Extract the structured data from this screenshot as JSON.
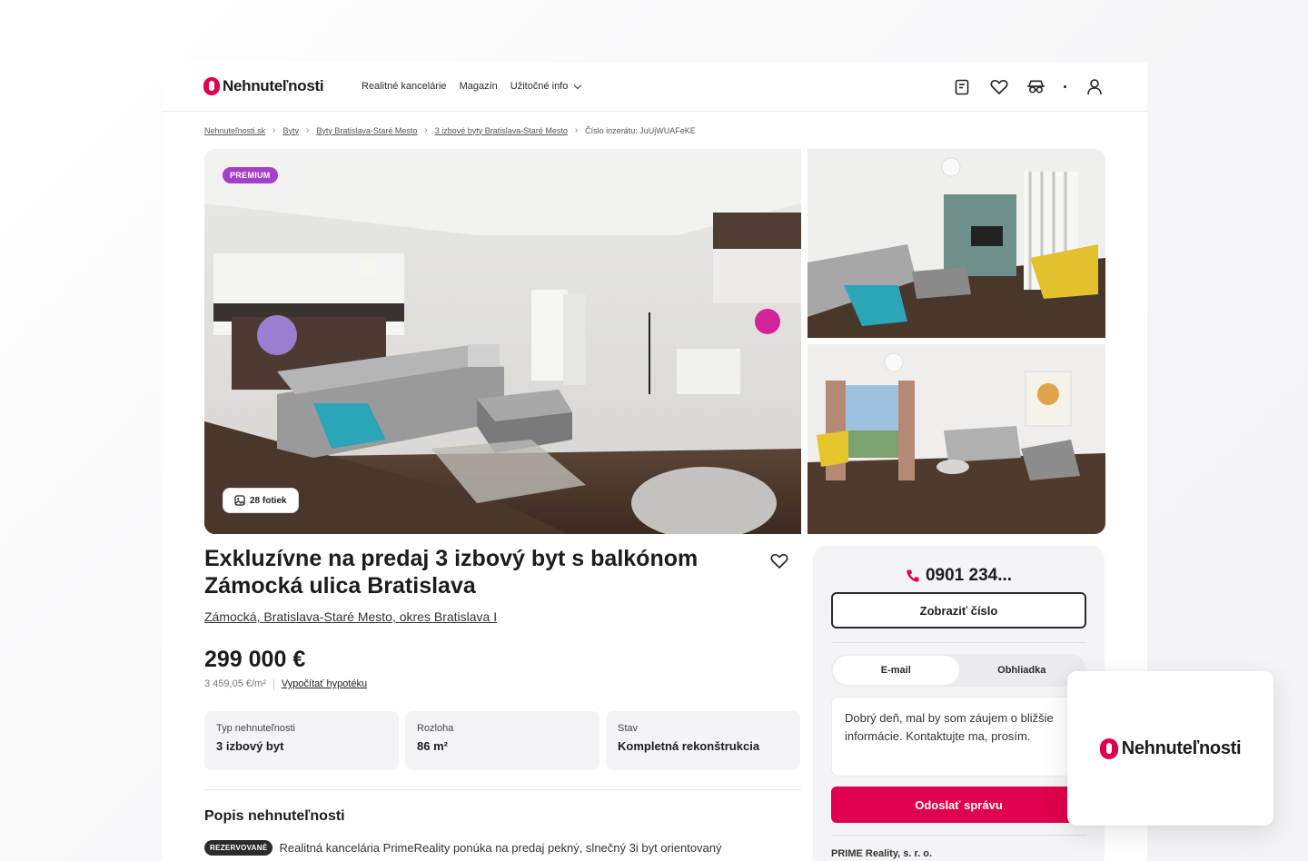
{
  "brand": {
    "name": "Nehnuteľnosti",
    "accent": "#e0004d"
  },
  "nav": {
    "items": [
      "Realitné kancelárie",
      "Magazín",
      "Užitočné info"
    ]
  },
  "header_icons": [
    "notepad-icon",
    "heart-icon",
    "incognito-icon",
    "user-icon"
  ],
  "breadcrumb": {
    "items": [
      "Nehnuteľnosti.sk",
      "Byty",
      "Byty Bratislava-Staré Mesto",
      "3 izbové byty Bratislava-Staré Mesto"
    ],
    "last": "Číslo inzerátu: JuUjWUAFeKE"
  },
  "gallery": {
    "badge": "PREMIUM",
    "photos_label": "28 fotiek"
  },
  "listing": {
    "title": "Exkluzívne na predaj 3 izbový byt s balkónom Zámocká ulica Bratislava",
    "address": "Zámocká, Bratislava-Staré Mesto, okres Bratislava I",
    "price": "299 000 €",
    "price_per_m2": "3 459,05 €/m²",
    "mortgage_link": "Vypočítať hypotéku"
  },
  "params": [
    {
      "label": "Typ nehnuteľnosti",
      "value": "3 izbový byt"
    },
    {
      "label": "Rozloha",
      "value": "86 m²"
    },
    {
      "label": "Stav",
      "value": "Kompletná rekonštrukcia"
    }
  ],
  "description": {
    "title": "Popis nehnuteľnosti",
    "badge": "REZERVOVANÉ",
    "text": "Realitná kancelária PrimeReality ponúka na predaj pekný, slnečný 3i byt orientovaný"
  },
  "contact": {
    "phone": "0901 234...",
    "show_number": "Zobraziť číslo",
    "tabs": [
      "E-mail",
      "Obhliadka"
    ],
    "message": "Dobrý deň, mal by som záujem o bližšie informácie. Kontaktujte ma, prosím.",
    "send": "Odoslať správu",
    "agency": "PRIME Reality, s. r. o."
  }
}
